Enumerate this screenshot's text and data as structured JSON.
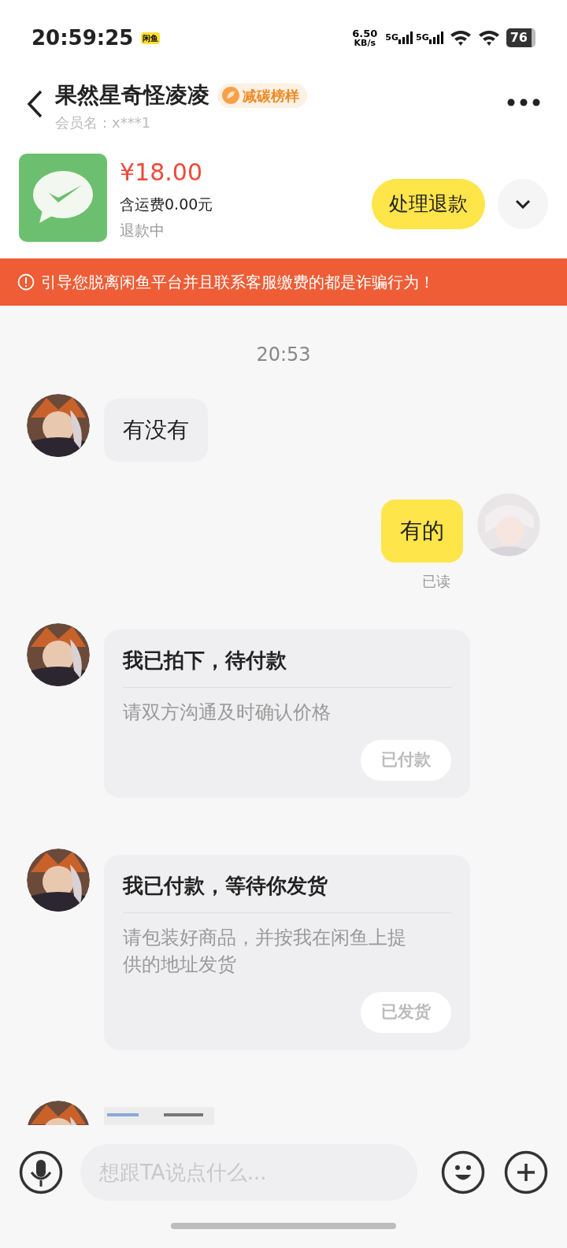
{
  "status_bar": {
    "time": "20:59:25",
    "app_badge": "闲鱼",
    "speed": "6.50",
    "speed_unit": "KB/s",
    "network_1": "5G",
    "network_2": "5G",
    "battery": "76"
  },
  "header": {
    "title": "果然星奇怪凌凌",
    "badge": "减碳榜样",
    "member": "会员名：x***1"
  },
  "product": {
    "price": "¥18.00",
    "shipping": "含运费0.00元",
    "status": "退款中",
    "action": "处理退款"
  },
  "warning": "引导您脱离闲鱼平台并且联系客服缴费的都是诈骗行为！",
  "messages": [
    {
      "kind": "time",
      "text": "20:53"
    },
    {
      "kind": "text",
      "outgoing": false,
      "text": "有没有"
    },
    {
      "kind": "text",
      "outgoing": true,
      "text": "有的",
      "receipt": "已读"
    },
    {
      "kind": "card",
      "outgoing": false,
      "title": "我已拍下，待付款",
      "body": "请双方沟通及时确认价格",
      "button": "已付款"
    },
    {
      "kind": "card",
      "outgoing": false,
      "title": "我已付款，等待你发货",
      "body": "请包装好商品，并按我在闲鱼上提供的地址发货",
      "button": "已发货"
    },
    {
      "kind": "picture",
      "outgoing": false
    }
  ],
  "input": {
    "placeholder": "想跟TA说点什么..."
  }
}
